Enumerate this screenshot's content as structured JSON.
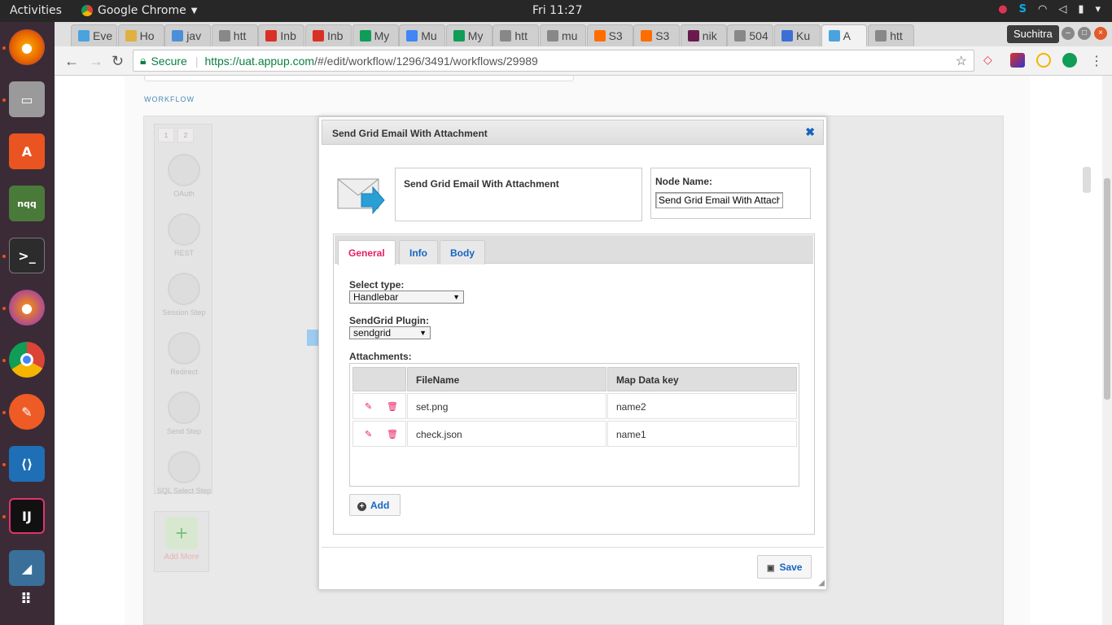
{
  "topbar": {
    "activities": "Activities",
    "app_name": "Google Chrome",
    "clock": "Fri 11:27"
  },
  "chrome": {
    "tabs": [
      "Eve",
      "Ho",
      "jav",
      "htt",
      "Inb",
      "Inb",
      "My",
      "Mu",
      "My",
      "htt",
      "mu",
      "S3",
      "S3",
      "nik",
      "504",
      "Ku",
      "A",
      "htt"
    ],
    "user": "Suchitra",
    "secure_label": "Secure",
    "url_base": "https://uat.appup.com",
    "url_rest": "/#/edit/workflow/1296/3491/workflows/29989"
  },
  "workflow": {
    "section_label": "WORKFLOW",
    "palette_tabs": [
      "1",
      "2"
    ],
    "palette_items": [
      "OAuth",
      "REST",
      "Session Step",
      "Redirect",
      "Send Step",
      "SQL Select Step"
    ],
    "add_more": "Add More"
  },
  "modal": {
    "title": "Send Grid Email With Attachment",
    "description": "Send Grid Email With Attachment",
    "node_name_label": "Node Name:",
    "node_name_value": "Send Grid Email With Attachment",
    "tabs": [
      "General",
      "Info",
      "Body"
    ],
    "active_tab": "General",
    "select_type_label": "Select type:",
    "select_type_value": "Handlebar",
    "plugin_label": "SendGrid Plugin:",
    "plugin_value": "sendgrid",
    "attachments_label": "Attachments:",
    "columns": [
      "FileName",
      "Map Data key"
    ],
    "rows": [
      {
        "file": "set.png",
        "key": "name2"
      },
      {
        "file": "check.json",
        "key": "name1"
      }
    ],
    "add_label": "Add",
    "save_label": "Save"
  },
  "colors": {
    "accent_pink": "#e91e63",
    "link_blue": "#1565c0",
    "dock_bg": "#3b2b36"
  }
}
